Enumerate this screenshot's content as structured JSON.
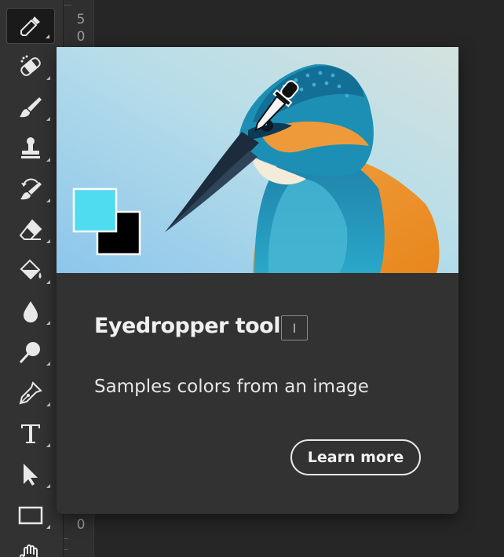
{
  "toolbar": {
    "tools": [
      {
        "name": "eyedropper-tool",
        "icon": "eyedropper-icon",
        "active": true
      },
      {
        "name": "spot-healing-tool",
        "icon": "bandage-icon"
      },
      {
        "name": "brush-tool",
        "icon": "brush-icon"
      },
      {
        "name": "clone-stamp-tool",
        "icon": "stamp-icon"
      },
      {
        "name": "history-brush-tool",
        "icon": "history-brush-icon"
      },
      {
        "name": "eraser-tool",
        "icon": "eraser-icon"
      },
      {
        "name": "paint-bucket-tool",
        "icon": "paint-bucket-icon"
      },
      {
        "name": "blur-tool",
        "icon": "drop-icon"
      },
      {
        "name": "dodge-tool",
        "icon": "dodge-icon"
      },
      {
        "name": "pen-tool",
        "icon": "pen-nib-icon"
      },
      {
        "name": "type-tool",
        "icon": "type-icon"
      },
      {
        "name": "path-selection-tool",
        "icon": "arrow-cursor-icon"
      },
      {
        "name": "rectangle-tool",
        "icon": "rectangle-icon"
      },
      {
        "name": "hand-tool",
        "icon": "hand-icon"
      }
    ]
  },
  "ruler": {
    "top_digits": [
      "5",
      "0"
    ],
    "bottom_digit": "0"
  },
  "tooltip": {
    "title": "Eyedropper tool",
    "shortcut": "I",
    "description": "Samples colors from an image",
    "learn_more_label": "Learn more",
    "swatch_foreground": "#4fdbf0",
    "swatch_background": "#000000"
  },
  "colors": {
    "toolbar_bg": "#323232",
    "panel_bg": "#323232",
    "canvas_bg": "#262626",
    "accent_sky": "#a8d4e8"
  }
}
